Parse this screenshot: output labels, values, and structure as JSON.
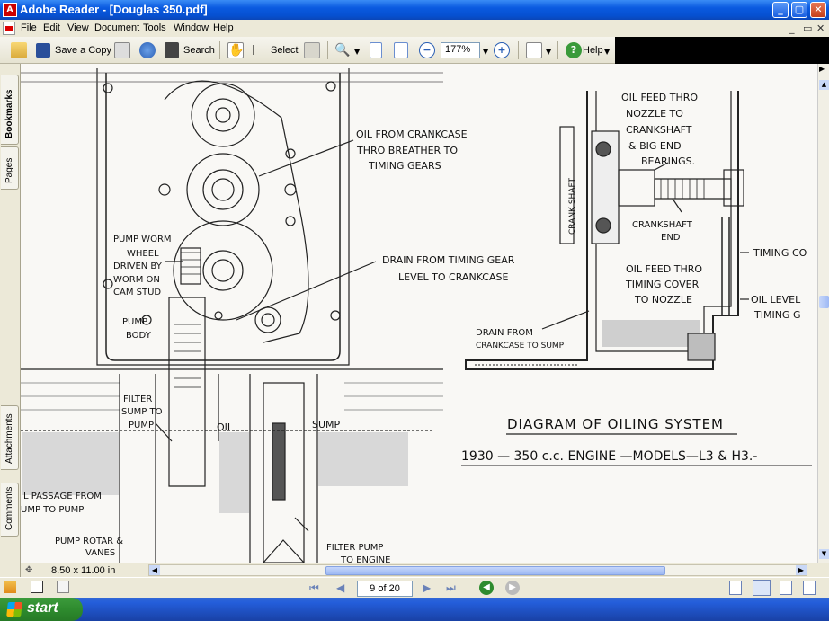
{
  "window": {
    "title": "Adobe Reader - [Douglas 350.pdf]",
    "app_icon": "pdf-icon",
    "buttons": {
      "minimize": "_",
      "maximize": "▢",
      "close": "✕"
    }
  },
  "menu": {
    "items": [
      "File",
      "Edit",
      "View",
      "Document",
      "Tools",
      "Window",
      "Help"
    ],
    "mdi": {
      "minimize": "_",
      "restore": "▭",
      "close": "✕"
    }
  },
  "toolbar": {
    "save_copy": "Save a Copy",
    "search": "Search",
    "select": "Select",
    "zoom": "177%",
    "help": "Help"
  },
  "side_tabs": {
    "bookmarks": "Bookmarks",
    "pages": "Pages",
    "attachments": "Attachments",
    "comments": "Comments"
  },
  "status": {
    "page_size": "8.50 x 11.00 in",
    "page": "9 of 20"
  },
  "taskbar": {
    "start": "start"
  },
  "document": {
    "left_labels": {
      "oil_from_crankcase": [
        "OIL FROM CRANKCASE",
        "THRO BREATHER TO",
        "TIMING GEARS"
      ],
      "pump_worm": [
        "PUMP WORM",
        "WHEEL",
        "DRIVEN BY",
        "WORM ON",
        "CAM STUD"
      ],
      "pump_body": [
        "PUMP",
        "BODY"
      ],
      "drain_timing": [
        "DRAIN FROM TIMING GEAR",
        "LEVEL TO CRANKCASE"
      ],
      "filter_sump": [
        "FILTER",
        "SUMP TO",
        "PUMP"
      ],
      "oil": "OIL",
      "sump": "SUMP",
      "oil_passage": [
        "IL PASSAGE FROM",
        "UMP TO PUMP"
      ],
      "pump_rotor": [
        "PUMP ROTAR &",
        "VANES"
      ],
      "filter_pump": [
        "FILTER PUMP",
        "TO ENGINE"
      ]
    },
    "right_labels": {
      "oil_feed_thro": [
        "OIL FEED THRO",
        "NOZZLE TO",
        "CRANKSHAFT",
        "& BIG END",
        "BEARINGS."
      ],
      "crank_shaft": "CRANK SHAFT",
      "crankshaft_end": [
        "CRANKSHAFT",
        "END"
      ],
      "timing_cover_1": "TIMING CO",
      "oil_feed_cover": [
        "OIL FEED THRO",
        "TIMING COVER",
        "TO NOZZLE"
      ],
      "oil_level": [
        "OIL LEVEL",
        "TIMING G"
      ],
      "drain_crankcase": [
        "DRAIN FROM",
        "CRANKCASE TO SUMP"
      ]
    },
    "caption_title": "DIAGRAM OF OILING SYSTEM",
    "caption_sub": "1930 — 350 c.c. ENGINE —MODELS—L3 & H3.-"
  }
}
